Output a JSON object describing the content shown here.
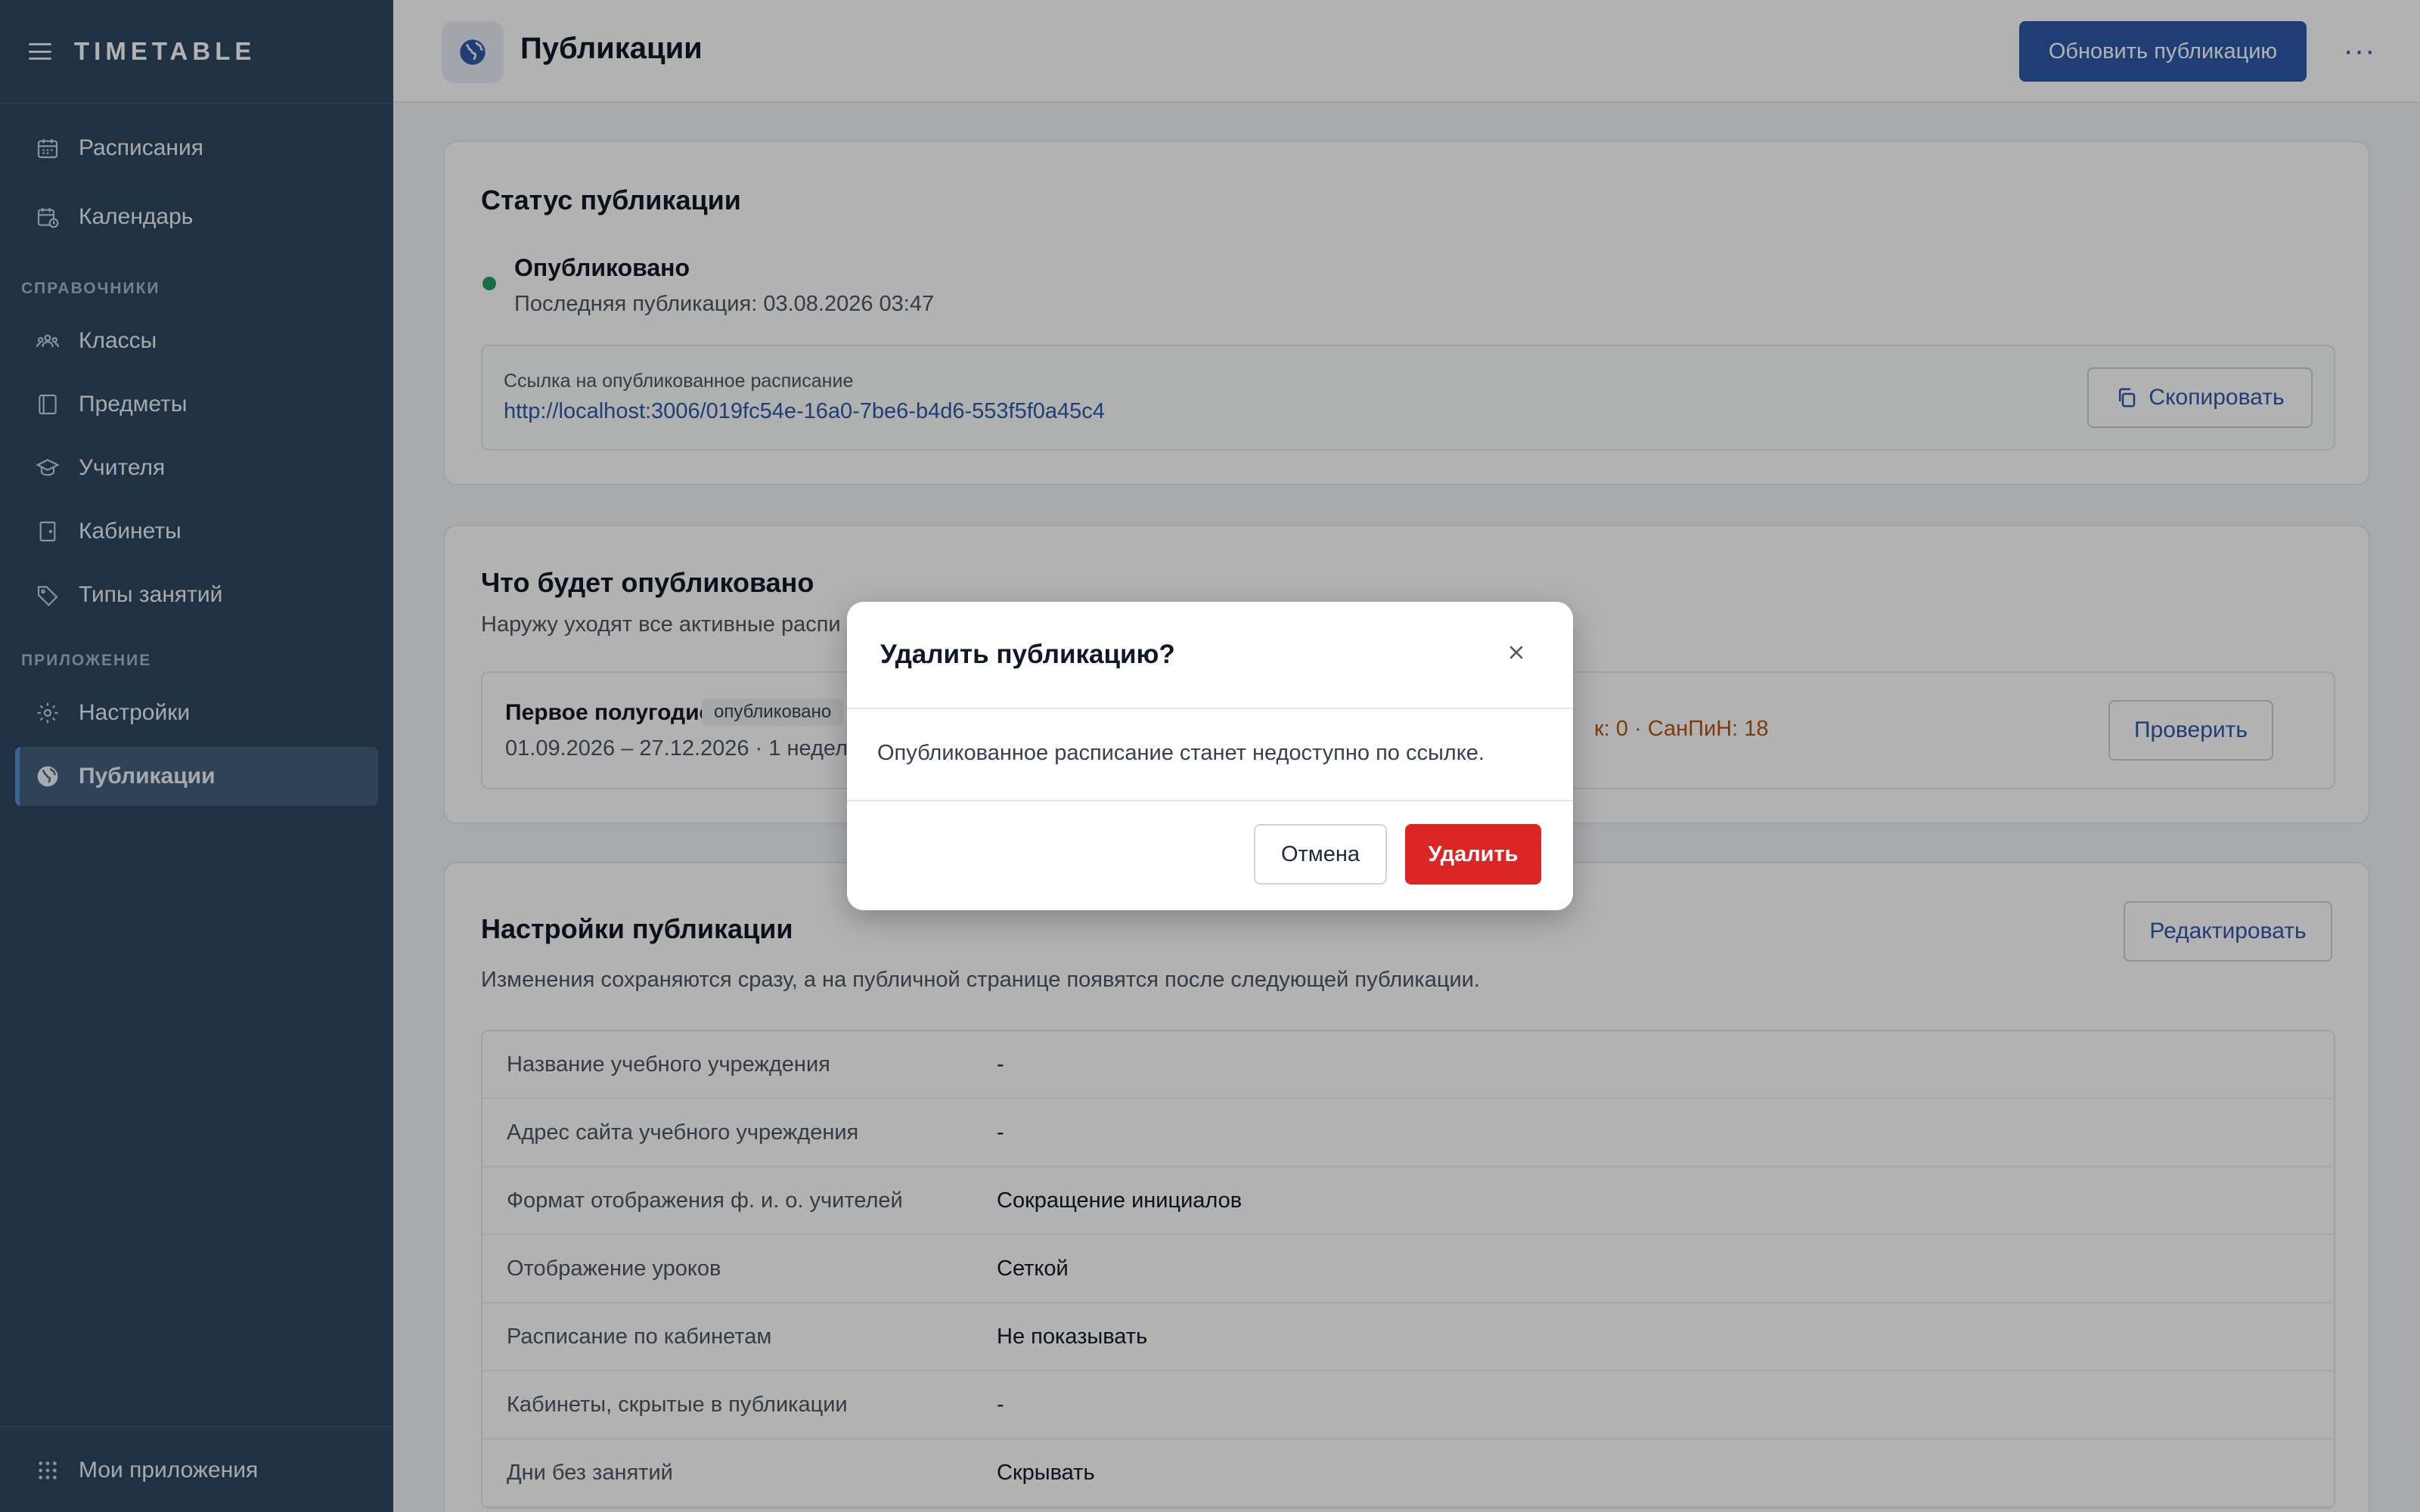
{
  "app": {
    "logo": "TIMETABLE"
  },
  "sidebar": {
    "top_items": [
      {
        "label": "Расписания",
        "icon": "calendar-grid-icon"
      },
      {
        "label": "Календарь",
        "icon": "calendar-clock-icon"
      }
    ],
    "section_refs": "СПРАВОЧНИКИ",
    "ref_items": [
      {
        "label": "Классы",
        "icon": "group-icon"
      },
      {
        "label": "Предметы",
        "icon": "book-icon"
      },
      {
        "label": "Учителя",
        "icon": "graduation-cap-icon"
      },
      {
        "label": "Кабинеты",
        "icon": "door-icon"
      },
      {
        "label": "Типы занятий",
        "icon": "tag-icon"
      }
    ],
    "section_app": "ПРИЛОЖЕНИЕ",
    "app_items": [
      {
        "label": "Настройки",
        "icon": "gear-icon"
      },
      {
        "label": "Публикации",
        "icon": "globe-icon",
        "active": true
      }
    ],
    "bottom_label": "Мои приложения"
  },
  "header": {
    "title": "Публикации",
    "update_button": "Обновить публикацию",
    "more": "···"
  },
  "status_card": {
    "title": "Статус публикации",
    "status": "Опубликовано",
    "last_published": "Последняя публикация: 03.08.2026 03:47",
    "link_label": "Ссылка на опубликованное расписание",
    "link_url": "http://localhost:3006/019fc54e-16a0-7be6-b4d6-553f5f0a45c4",
    "copy_button": "Скопировать"
  },
  "what_card": {
    "title": "Что будет опубликовано",
    "subtitle": "Наружу уходят все активные распи",
    "item_name": "Первое полугодие",
    "item_badge": "опубликовано",
    "item_dates": "01.09.2026 – 27.12.2026 · 1 неделя",
    "item_warnings": "к: 0 · СанПиН: 18",
    "check_button": "Проверить"
  },
  "settings_card": {
    "title": "Настройки публикации",
    "subtitle": "Изменения сохраняются сразу, а на публичной странице появятся после следующей публикации.",
    "edit_button": "Редактировать",
    "rows": [
      {
        "key": "Название учебного учреждения",
        "value": "-"
      },
      {
        "key": "Адрес сайта учебного учреждения",
        "value": "-"
      },
      {
        "key": "Формат отображения ф. и. о. учителей",
        "value": "Сокращение инициалов"
      },
      {
        "key": "Отображение уроков",
        "value": "Сеткой"
      },
      {
        "key": "Расписание по кабинетам",
        "value": "Не показывать"
      },
      {
        "key": "Кабинеты, скрытые в публикации",
        "value": "-"
      },
      {
        "key": "Дни без занятий",
        "value": "Скрывать"
      }
    ]
  },
  "modal": {
    "title": "Удалить публикацию?",
    "text": "Опубликованное расписание станет недоступно по ссылке.",
    "cancel": "Отмена",
    "delete": "Удалить"
  },
  "colors": {
    "sidebar_bg": "#2f4761",
    "primary": "#2c5aa8",
    "danger": "#dc2626",
    "success": "#1aa160",
    "warning_text": "#b45309"
  }
}
